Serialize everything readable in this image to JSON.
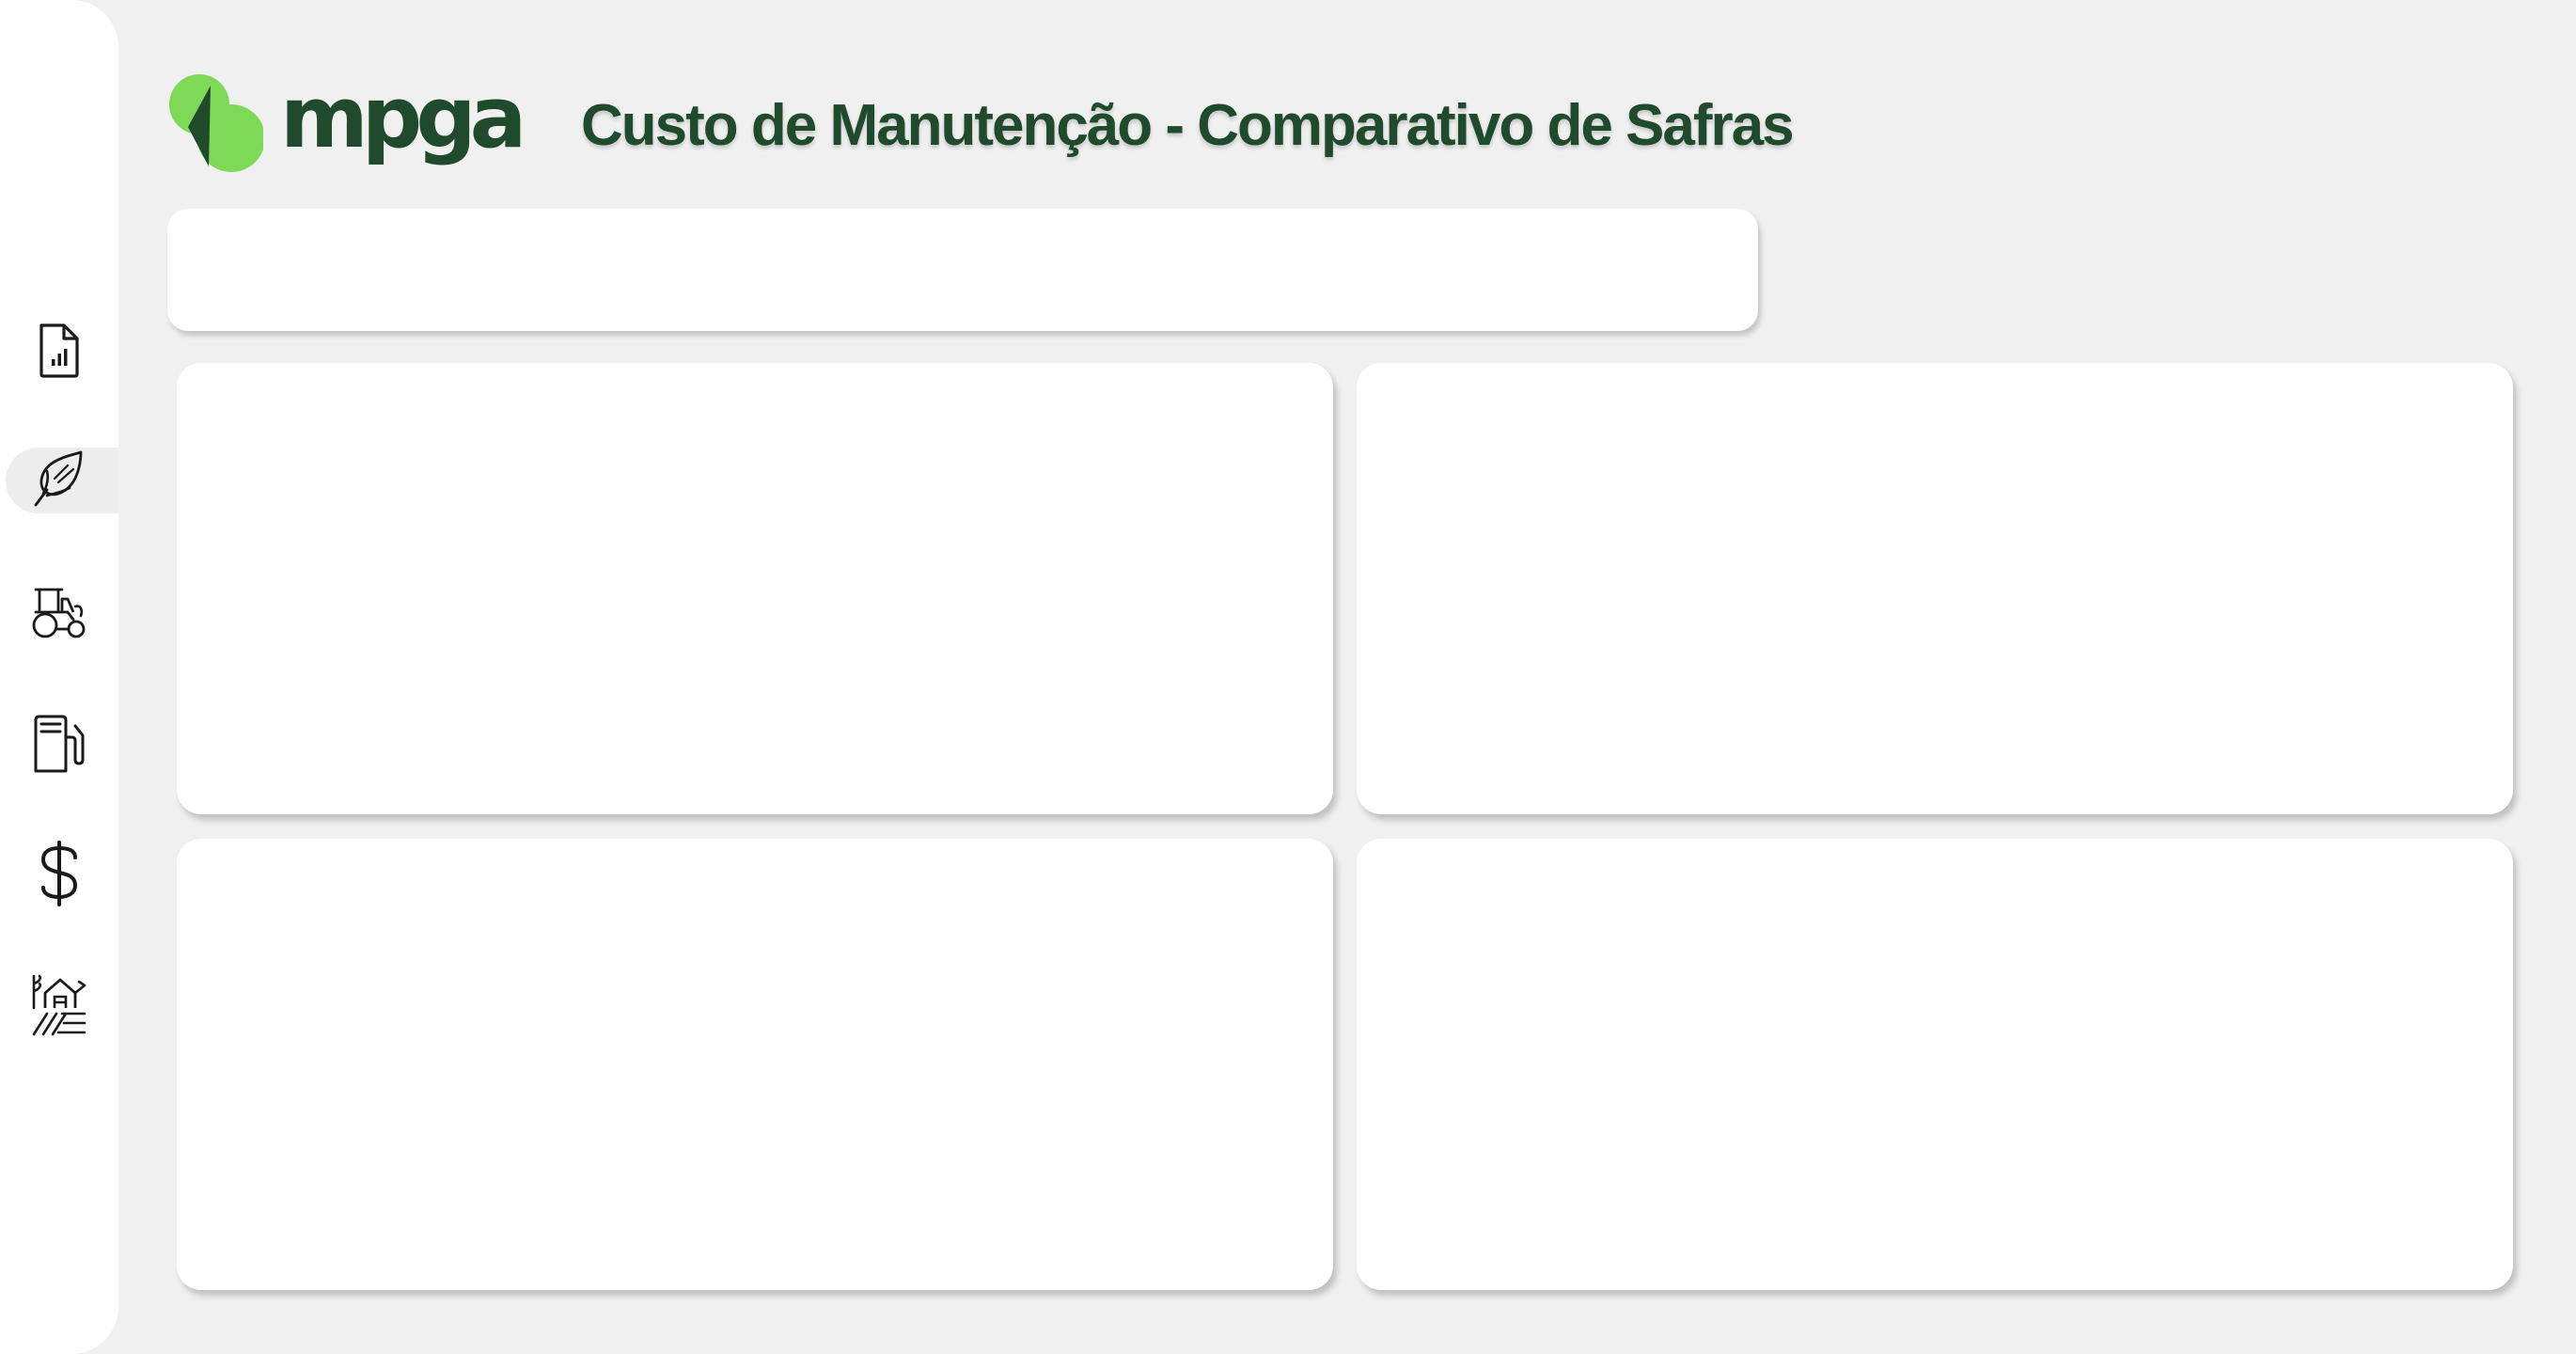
{
  "brand": {
    "name": "mpga",
    "colors": {
      "logo_light": "#7ed957",
      "logo_dark": "#1f4a2c",
      "title": "#1f4a2c"
    }
  },
  "header": {
    "title": "Custo de Manutenção - Comparativo de Safras"
  },
  "sidebar": {
    "items": [
      {
        "icon": "report-document-icon",
        "active": false
      },
      {
        "icon": "corn-icon",
        "active": true
      },
      {
        "icon": "tractor-icon",
        "active": false
      },
      {
        "icon": "fuel-pump-icon",
        "active": false
      },
      {
        "icon": "dollar-icon",
        "active": false
      },
      {
        "icon": "farm-icon",
        "active": false
      }
    ]
  },
  "panels": {
    "filter_bar": "",
    "cards": [
      "",
      "",
      "",
      ""
    ]
  },
  "colors": {
    "background": "#f0f0f0",
    "surface": "#ffffff",
    "active_nav": "#ededed"
  }
}
